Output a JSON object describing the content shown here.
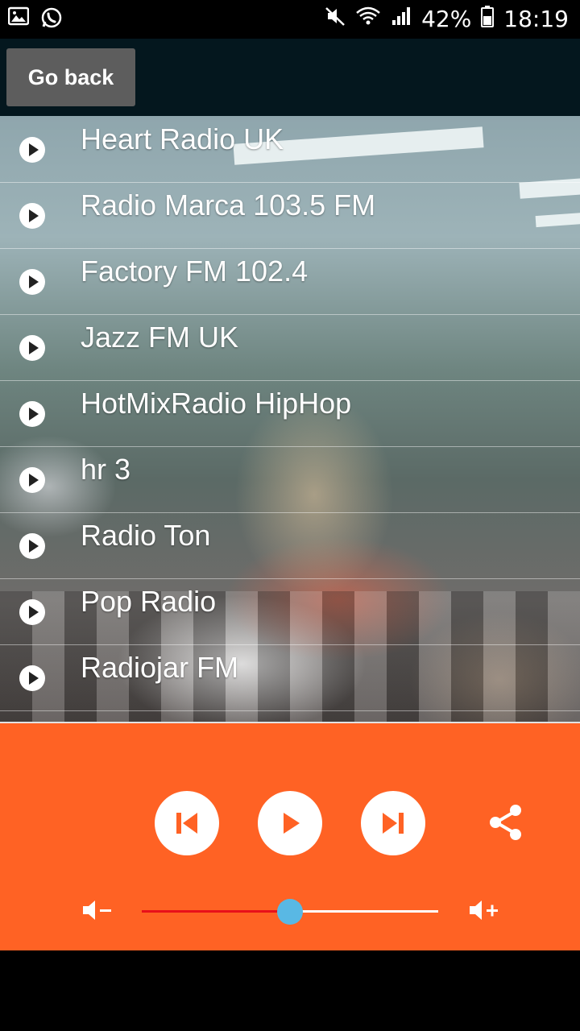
{
  "status_bar": {
    "battery": "42%",
    "time": "18:19",
    "icons": [
      "gallery-icon",
      "whatsapp-icon",
      "mute-icon",
      "wifi-icon",
      "signal-icon",
      "battery-icon"
    ]
  },
  "header": {
    "back_label": "Go back"
  },
  "stations": [
    {
      "name": "Heart Radio UK"
    },
    {
      "name": "Radio Marca 103.5 FM"
    },
    {
      "name": "Factory FM 102.4"
    },
    {
      "name": "Jazz FM UK"
    },
    {
      "name": "HotMixRadio HipHop"
    },
    {
      "name": "hr 3"
    },
    {
      "name": "Radio Ton"
    },
    {
      "name": "Pop Radio"
    },
    {
      "name": "Radiojar FM"
    }
  ],
  "player": {
    "controls": [
      "previous-icon",
      "play-icon",
      "next-icon",
      "share-icon"
    ],
    "volume_level": 0.5
  },
  "colors": {
    "player_bg": "#ff6224",
    "header_bg": "#04171e",
    "slider_fill": "#e8101a",
    "slider_thumb": "#59b8e4"
  }
}
